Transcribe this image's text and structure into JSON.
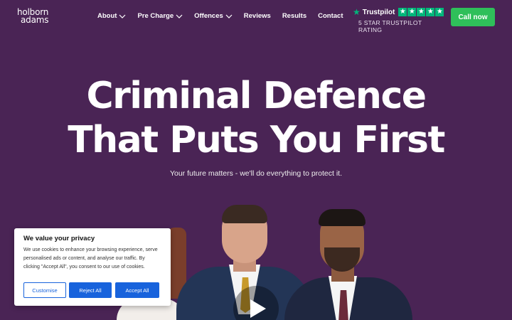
{
  "logo": {
    "line1": "holborn",
    "line2": "adams"
  },
  "nav": {
    "items": [
      {
        "label": "About",
        "dropdown": true
      },
      {
        "label": "Pre Charge",
        "dropdown": true
      },
      {
        "label": "Offences",
        "dropdown": true
      },
      {
        "label": "Reviews",
        "dropdown": false
      },
      {
        "label": "Results",
        "dropdown": false
      },
      {
        "label": "Contact",
        "dropdown": false
      }
    ]
  },
  "trustpilot": {
    "name": "Trustpilot",
    "rating_stars": 5,
    "caption": "5 STAR TRUSTPILOT RATING",
    "color": "#00b67a"
  },
  "call_button": {
    "label": "Call now",
    "color": "#2fbf5a"
  },
  "hero": {
    "title_line1": "Criminal Defence",
    "title_line2": "That Puts You First",
    "subtitle": "Your future matters - we'll do everything to protect it.",
    "background": "#4a2455"
  },
  "cookie_banner": {
    "title": "We value your privacy",
    "text": "We use cookies to enhance your browsing experience, serve personalised ads or content, and analyse our traffic. By clicking \"Accept All\", you consent to our use of cookies.",
    "customise_label": "Customise",
    "reject_label": "Reject All",
    "accept_label": "Accept All",
    "accent": "#1863dc"
  },
  "icons": {
    "nav_dropdown": "chevron-down-icon",
    "trustpilot": "star-icon",
    "video": "play-icon"
  }
}
